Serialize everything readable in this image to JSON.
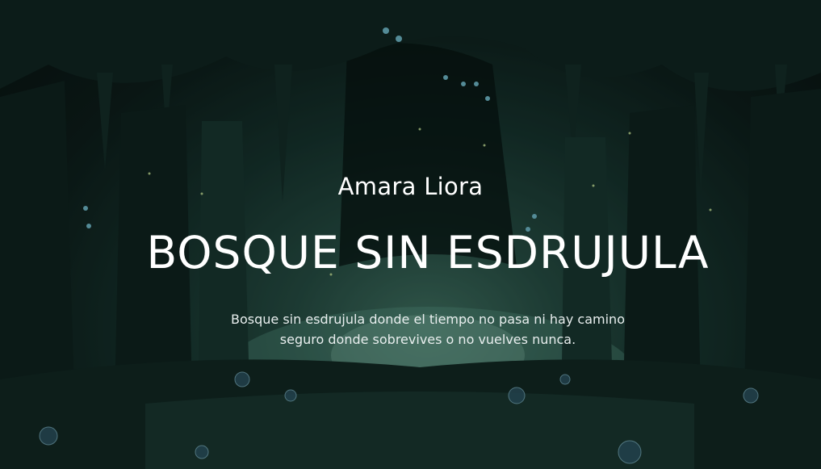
{
  "cover": {
    "author": "Amara Liora",
    "title": "BOSQUE SIN ESDRUJULA",
    "description": "Bosque sin esdrujula donde el tiempo no pasa ni hay camino seguro donde sobrevives o no vuelves nunca."
  },
  "background": {
    "scene": "dark-cave-forest",
    "accent_color": "#3f6e5e"
  }
}
